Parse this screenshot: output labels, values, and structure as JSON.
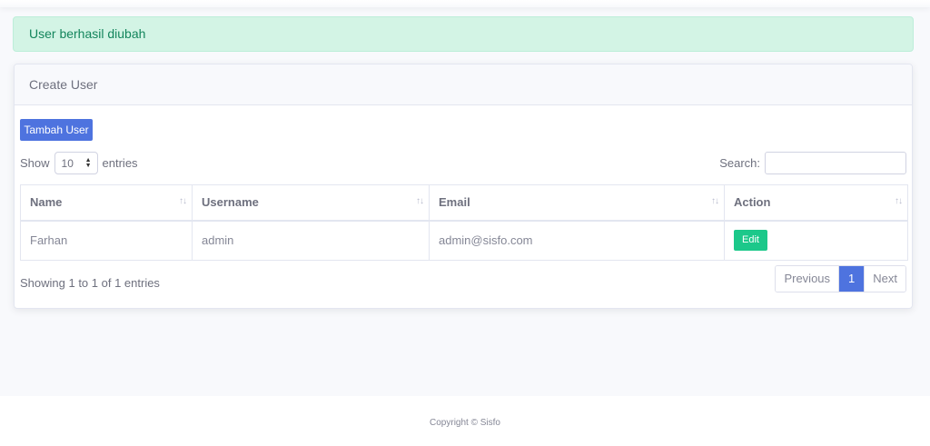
{
  "alert": {
    "text": "User berhasil diubah"
  },
  "card": {
    "title": "Create User"
  },
  "toolbar": {
    "add_label": "Tambah User"
  },
  "length": {
    "show_label": "Show",
    "value": "10",
    "entries_label": "entries"
  },
  "search": {
    "label": "Search:",
    "value": ""
  },
  "table": {
    "columns": [
      "Name",
      "Username",
      "Email",
      "Action"
    ],
    "rows": [
      {
        "name": "Farhan",
        "username": "admin",
        "email": "admin@sisfo.com",
        "action": "Edit"
      }
    ]
  },
  "info": "Showing 1 to 1 of 1 entries",
  "pagination": {
    "previous": "Previous",
    "current": "1",
    "next": "Next"
  },
  "footer": {
    "text": "Copyright © Sisfo"
  },
  "colors": {
    "primary": "#4e73df",
    "success": "#1cc88a",
    "alert_bg": "#d3f4e5",
    "alert_text": "#13855c"
  }
}
